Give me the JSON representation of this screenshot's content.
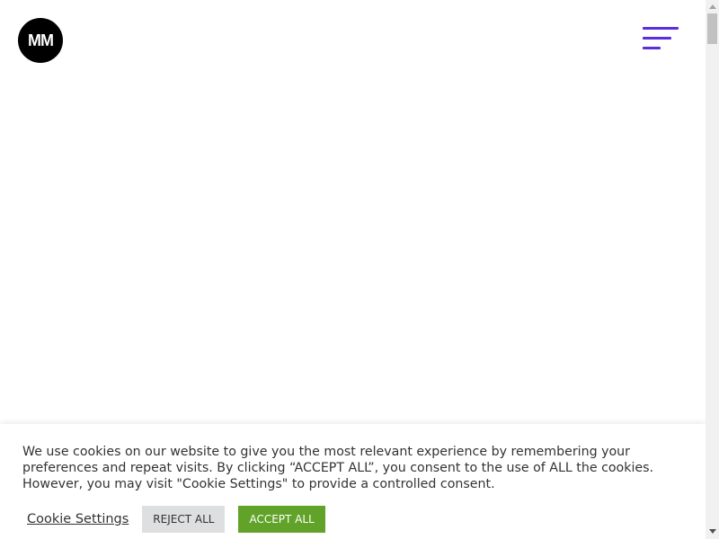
{
  "header": {
    "logo_text": "MM",
    "menu_icon": "hamburger-menu-icon",
    "accent_color": "#5b2ee0"
  },
  "cookie_banner": {
    "message": "We use cookies on our website to give you the most relevant experience by remembering your preferences and repeat visits. By clicking “ACCEPT ALL”, you consent to the use of ALL the cookies. However, you may visit \"Cookie Settings\" to provide a controlled consent.",
    "settings_label": "Cookie Settings",
    "reject_label": "REJECT ALL",
    "accept_label": "ACCEPT ALL",
    "accept_color": "#61a229",
    "reject_color": "#dedfe0"
  }
}
